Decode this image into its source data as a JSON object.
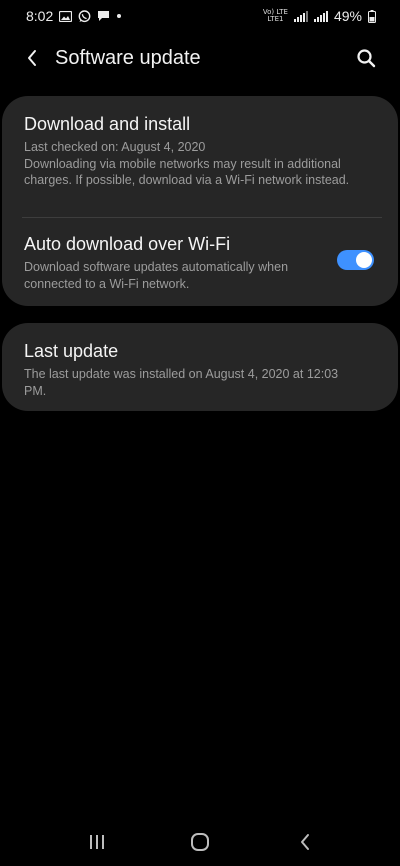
{
  "status_bar": {
    "time": "8:02",
    "network_top": "Vo) LTE",
    "network_bottom": "LTE1",
    "battery": "49%"
  },
  "app_bar": {
    "title": "Software update",
    "back_icon": "chevron-left-icon",
    "search_icon": "search-icon"
  },
  "items": {
    "download_install": {
      "title": "Download and install",
      "subtitle": "Last checked on: August 4, 2020\nDownloading via mobile networks may result in additional charges. If possible, download via a Wi-Fi network instead."
    },
    "auto_download": {
      "title": "Auto download over Wi-Fi",
      "subtitle": "Download software updates automatically when connected to a Wi-Fi network.",
      "enabled": true
    },
    "last_update": {
      "title": "Last update",
      "subtitle": "The last update was installed on August 4, 2020 at 12:03 PM."
    }
  },
  "colors": {
    "background": "#000000",
    "card": "#262626",
    "toggle_on": "#3e91ff",
    "text_primary": "#f4f4f4",
    "text_secondary": "#9c9c9c"
  },
  "nav_bar": {
    "recents_icon": "recents-icon",
    "home_icon": "home-icon",
    "back_icon": "back-icon"
  }
}
